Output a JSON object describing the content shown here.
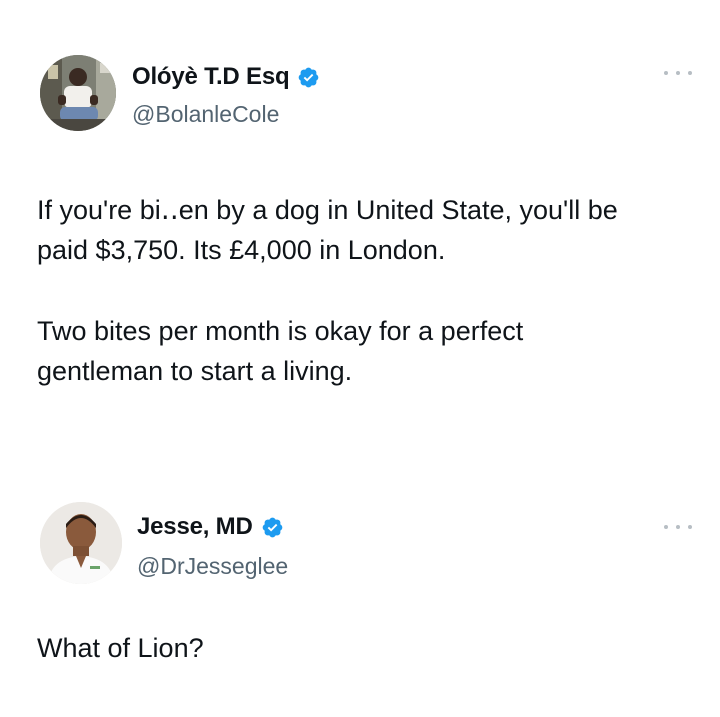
{
  "tweets": [
    {
      "display_name": "Olóyè T.D Esq",
      "handle": "@BolanleCole",
      "verified": true,
      "avatar_icon": "person-seated-photo",
      "text_lines": [
        "If you're bi․․en by a dog in United State, you'll be",
        "paid $3,750. Its £4,000 in London.",
        "Two bites per month is okay for a perfect",
        "gentleman to start a living."
      ]
    },
    {
      "display_name": "Jesse, MD",
      "handle": "@DrJesseglee",
      "verified": true,
      "avatar_icon": "person-portrait-photo",
      "text_lines": [
        "What of Lion?"
      ]
    }
  ],
  "colors": {
    "verified_blue": "#1d9bf0",
    "handle_gray": "#536471",
    "text": "#0f1419"
  }
}
